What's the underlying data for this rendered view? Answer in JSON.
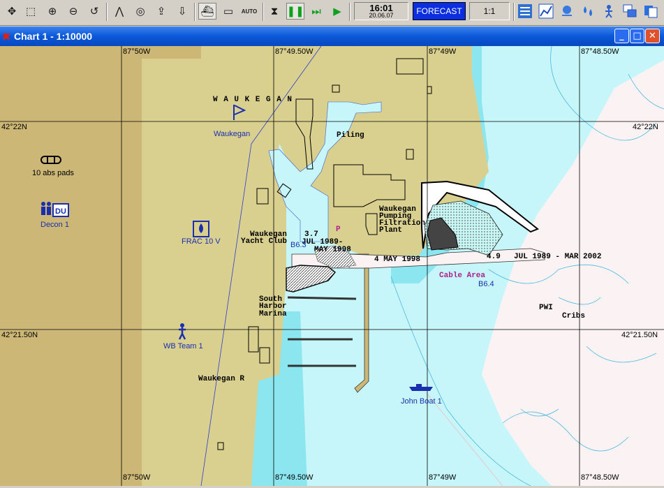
{
  "toolbar": {
    "buttons": [
      {
        "name": "move-icon",
        "glyph": "✥"
      },
      {
        "name": "select-icon",
        "glyph": "⬚"
      },
      {
        "name": "zoom-in-icon",
        "glyph": "⊕"
      },
      {
        "name": "zoom-out-icon",
        "glyph": "⊖"
      },
      {
        "name": "undo-icon",
        "glyph": "↺"
      },
      {
        "name": "compass-icon",
        "glyph": "⋀"
      },
      {
        "name": "target-icon",
        "glyph": "◎"
      },
      {
        "name": "import-icon",
        "glyph": "⇪"
      },
      {
        "name": "export-icon",
        "glyph": "⇩"
      },
      {
        "name": "ship-icon",
        "glyph": "⛴"
      },
      {
        "name": "vessel-icon",
        "glyph": "▭"
      },
      {
        "name": "auto-label",
        "glyph": "AUTO"
      },
      {
        "name": "stop-icon",
        "glyph": "⧗"
      },
      {
        "name": "pause-icon",
        "glyph": "❚❚"
      },
      {
        "name": "fast-forward-icon",
        "glyph": "⏭"
      },
      {
        "name": "play-icon",
        "glyph": "▶"
      }
    ],
    "time": "16:01",
    "date": "20.06.07",
    "forecast_label": "FORECAST",
    "scale_label": "1:1",
    "right_icons": [
      "layers-icon",
      "chart-icon",
      "weather-icon",
      "drops-icon",
      "person-icon",
      "windows-icon",
      "copy-icon"
    ]
  },
  "window": {
    "title": "Chart 1 - 1:10000",
    "min_glyph": "_",
    "max_glyph": "□",
    "close_glyph": "✕"
  },
  "coords": {
    "top": [
      "87°50W",
      "87°49.50W",
      "87°49W",
      "87°48.50W"
    ],
    "bottom": [
      "87°50W",
      "87°49.50W",
      "87°49W",
      "87°48.50W"
    ],
    "left": [
      "42°22N",
      "42°21.50N"
    ],
    "right": [
      "42°22N",
      "42°21.50N"
    ]
  },
  "labels": {
    "waukegan_town": "W A U K E G A N",
    "waukegan_flag": "Waukegan",
    "abs_pads": "10 abs pads",
    "decon": "Decon 1",
    "frac": "FRAC 10 V",
    "wb_team": "WB Team 1",
    "john_boat": "John Boat 1",
    "piling": "Piling",
    "pumping_1": "Waukegan",
    "pumping_2": "Pumping",
    "pumping_3": "Filtration",
    "pumping_4": "Plant",
    "yacht_1": "Waukegan",
    "yacht_2": "Yacht Club",
    "depth_37": "3.7",
    "jul1989": "JUL 1989-",
    "may1998": "MAY 1998",
    "b63": "B6.3",
    "p_mark": "P",
    "four_may": "4  MAY 1998",
    "depth_49": "4.9",
    "jul_mar": "JUL 1989 - MAR 2002",
    "cable": "Cable Area",
    "b64": "B6.4",
    "south_1": "South",
    "south_2": "Harbor",
    "south_3": "Marina",
    "pwi": "PWI",
    "cribs": "Cribs",
    "waukegan_r": "Waukegan R"
  }
}
